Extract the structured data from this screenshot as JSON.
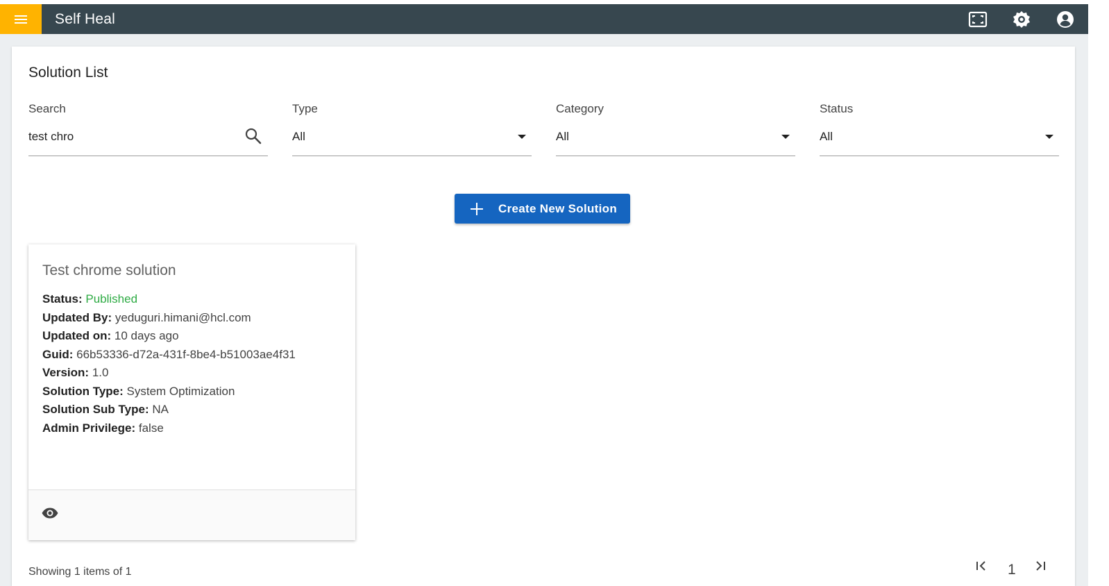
{
  "app": {
    "title": "Self Heal",
    "colors": {
      "appbar": "#37474f",
      "menu_button": "#ffb300",
      "primary_button": "#1565c0",
      "status_published": "#2eab44"
    },
    "icons": [
      "menu-icon",
      "fullscreen-icon",
      "settings-icon",
      "account-icon"
    ]
  },
  "page": {
    "title": "Solution List"
  },
  "filters": {
    "search": {
      "label": "Search",
      "value": "test chro"
    },
    "type": {
      "label": "Type",
      "value": "All"
    },
    "category": {
      "label": "Category",
      "value": "All"
    },
    "status": {
      "label": "Status",
      "value": "All"
    }
  },
  "create_button": {
    "label": "Create New Solution"
  },
  "cards": [
    {
      "title": "Test chrome solution",
      "fields": [
        {
          "key": "Status:",
          "value": "Published"
        },
        {
          "key": "Updated By:",
          "value": "yeduguri.himani@hcl.com"
        },
        {
          "key": "Updated on:",
          "value": "10 days ago"
        },
        {
          "key": "Guid:",
          "value": "66b53336-d72a-431f-8be4-b51003ae4f31"
        },
        {
          "key": "Version:",
          "value": "1.0"
        },
        {
          "key": "Solution Type:",
          "value": "System Optimization"
        },
        {
          "key": "Solution Sub Type:",
          "value": "NA"
        },
        {
          "key": "Admin Privilege:",
          "value": "false"
        }
      ]
    }
  ],
  "footer": {
    "showing": "Showing 1 items of 1",
    "pagination": {
      "first": "|<",
      "current_page": "1",
      "last": ">|"
    }
  }
}
